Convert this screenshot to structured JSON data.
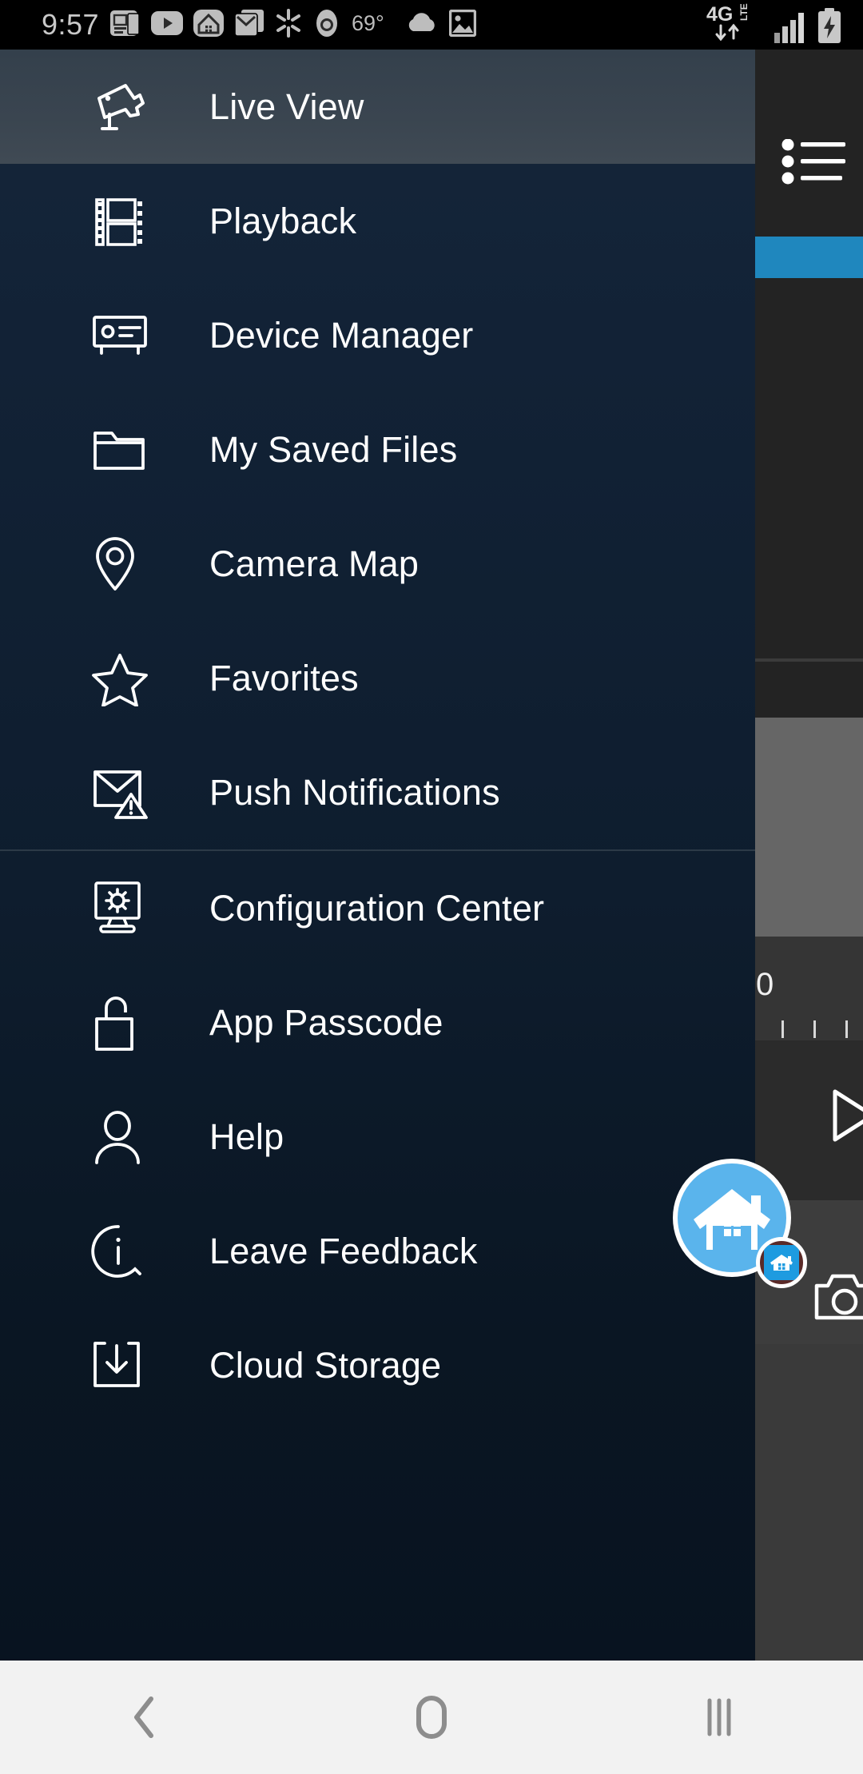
{
  "status_bar": {
    "time": "9:57",
    "temperature": "69°",
    "network_type": "4G LTE",
    "left_icons": [
      {
        "name": "news-icon"
      },
      {
        "name": "youtube-icon"
      },
      {
        "name": "nest-home-icon"
      },
      {
        "name": "email-icon"
      },
      {
        "name": "walmart-icon"
      },
      {
        "name": "chrome-icon"
      }
    ],
    "right_icons": [
      {
        "name": "cellular-signal-icon"
      },
      {
        "name": "battery-charging-icon"
      }
    ],
    "weather_icon": "cloud-icon",
    "gallery_icon": "image-icon"
  },
  "drawer": {
    "selected_index": 0,
    "separator_after_index": 6,
    "items": [
      {
        "label": "Live View",
        "icon": "cctv-camera-icon"
      },
      {
        "label": "Playback",
        "icon": "film-strip-icon"
      },
      {
        "label": "Device Manager",
        "icon": "device-card-icon"
      },
      {
        "label": "My Saved Files",
        "icon": "folder-icon"
      },
      {
        "label": "Camera Map",
        "icon": "map-pin-icon"
      },
      {
        "label": "Favorites",
        "icon": "star-icon"
      },
      {
        "label": "Push Notifications",
        "icon": "envelope-alert-icon"
      },
      {
        "label": "Configuration Center",
        "icon": "monitor-gear-icon"
      },
      {
        "label": "App Passcode",
        "icon": "padlock-open-icon"
      },
      {
        "label": "Help",
        "icon": "person-icon"
      },
      {
        "label": "Leave Feedback",
        "icon": "info-circle-icon"
      },
      {
        "label": "Cloud Storage",
        "icon": "download-box-icon"
      }
    ]
  },
  "background_app": {
    "list_menu_icon": "bulleted-list-icon",
    "timeline_label": "0",
    "play_icon": "play-triangle-icon",
    "snapshot_icon": "camera-snapshot-icon",
    "accent_color": "#1f87be",
    "panel_color": "#666666"
  },
  "floating_button": {
    "name": "smart-home-bubble",
    "icon": "house-icon",
    "badge_icon": "house-badge-icon",
    "color": "#5ab4ec"
  },
  "nav_bar": {
    "back": "back-chevron-icon",
    "home": "home-square-icon",
    "recents": "recents-bars-icon"
  }
}
